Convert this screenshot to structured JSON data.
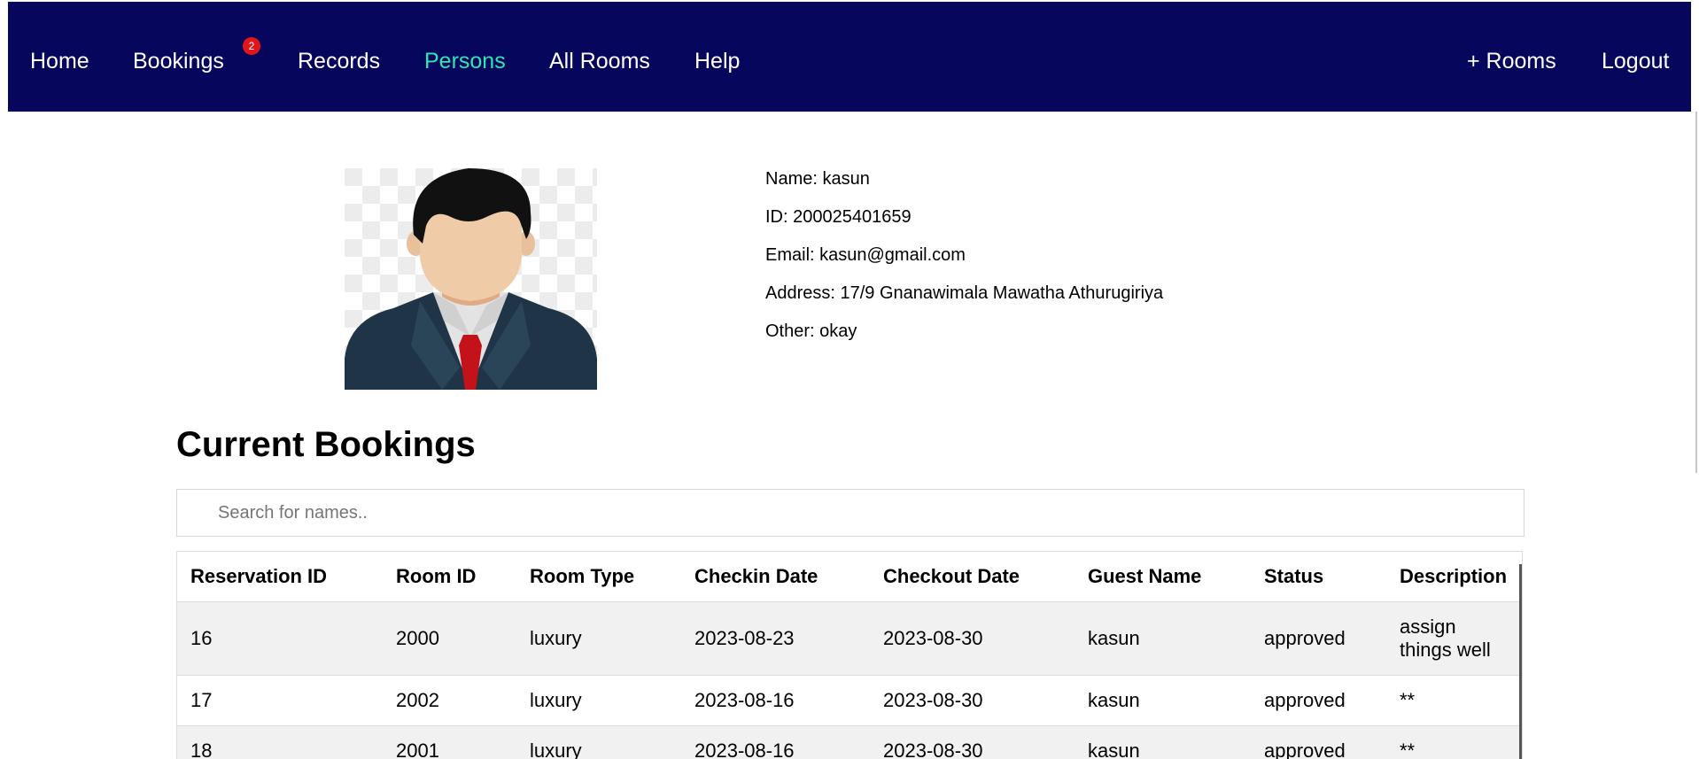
{
  "nav": {
    "home": "Home",
    "bookings": "Bookings",
    "bookings_badge": "2",
    "records": "Records",
    "persons": "Persons",
    "all_rooms": "All Rooms",
    "help": "Help",
    "add_rooms": "+ Rooms",
    "logout": "Logout"
  },
  "profile": {
    "name": "Name: kasun",
    "id": "ID: 200025401659",
    "email": "Email: kasun@gmail.com",
    "address": "Address: 17/9 Gnanawimala Mawatha Athurugiriya",
    "other": "Other: okay"
  },
  "bookings": {
    "title": "Current Bookings",
    "search_placeholder": "Search for names..",
    "columns": [
      "Reservation ID",
      "Room ID",
      "Room Type",
      "Checkin Date",
      "Checkout Date",
      "Guest Name",
      "Status",
      "Description"
    ],
    "rows": [
      [
        "16",
        "2000",
        "luxury",
        "2023-08-23",
        "2023-08-30",
        "kasun",
        "approved",
        "assign things well"
      ],
      [
        "17",
        "2002",
        "luxury",
        "2023-08-16",
        "2023-08-30",
        "kasun",
        "approved",
        "**"
      ],
      [
        "18",
        "2001",
        "luxury",
        "2023-08-16",
        "2023-08-30",
        "kasun",
        "approved",
        "**"
      ]
    ]
  },
  "colors": {
    "navbar_bg": "#06065c",
    "active_link": "#2ee6b2",
    "badge": "#e0161b"
  }
}
